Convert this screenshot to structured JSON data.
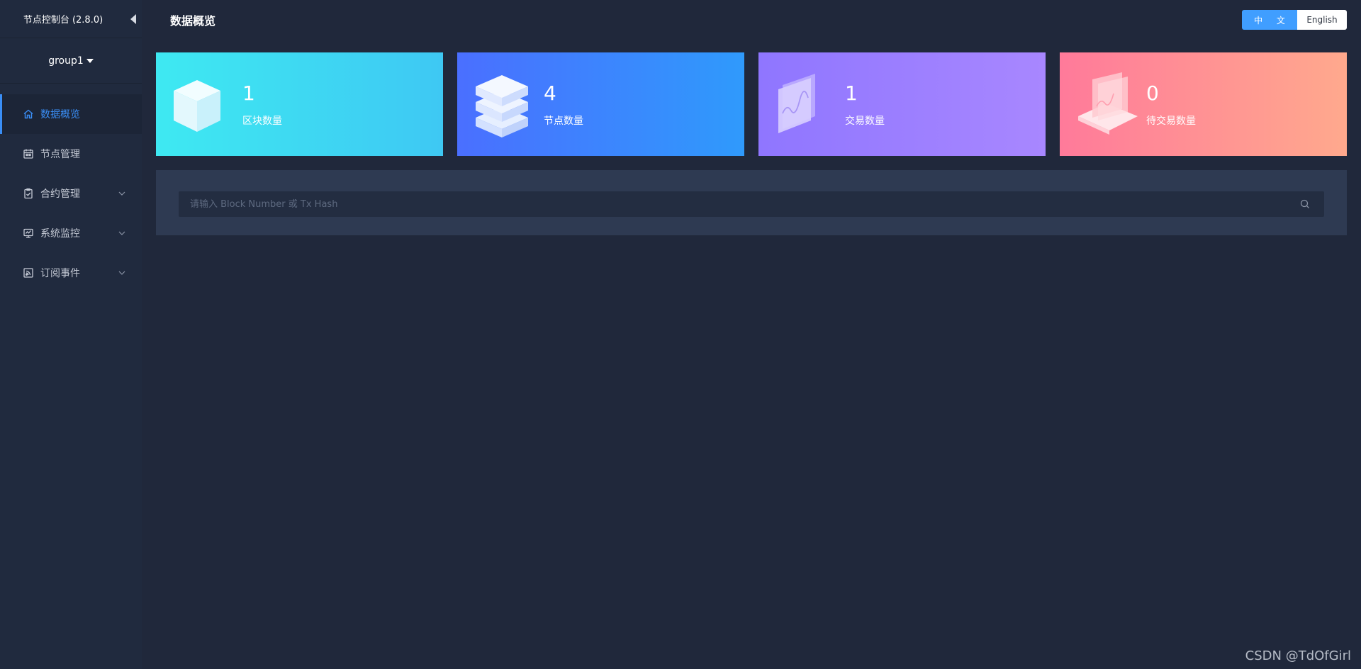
{
  "sidebar": {
    "title": "节点控制台 (2.8.0)",
    "group": "group1",
    "items": [
      {
        "label": "数据概览",
        "icon": "home-icon",
        "active": true
      },
      {
        "label": "节点管理",
        "icon": "calendar-icon"
      },
      {
        "label": "合约管理",
        "icon": "clipboard-icon",
        "expandable": true
      },
      {
        "label": "系统监控",
        "icon": "monitor-icon",
        "expandable": true
      },
      {
        "label": "订阅事件",
        "icon": "rss-icon",
        "expandable": true
      }
    ]
  },
  "header": {
    "title": "数据概览",
    "lang_zh": "中 文",
    "lang_en": "English"
  },
  "cards": [
    {
      "value": "1",
      "label": "区块数量",
      "icon": "cube-icon"
    },
    {
      "value": "4",
      "label": "节点数量",
      "icon": "server-icon"
    },
    {
      "value": "1",
      "label": "交易数量",
      "icon": "chart-panel-icon"
    },
    {
      "value": "0",
      "label": "待交易数量",
      "icon": "laptop-chart-icon"
    }
  ],
  "search": {
    "placeholder": "请输入 Block Number 或 Tx Hash"
  },
  "watermark": "CSDN @TdOfGirl",
  "colors": {
    "background": "#20283b",
    "sidebar": "#202a3e",
    "accent": "#3a8ef6",
    "search_panel": "#2e3a52"
  }
}
